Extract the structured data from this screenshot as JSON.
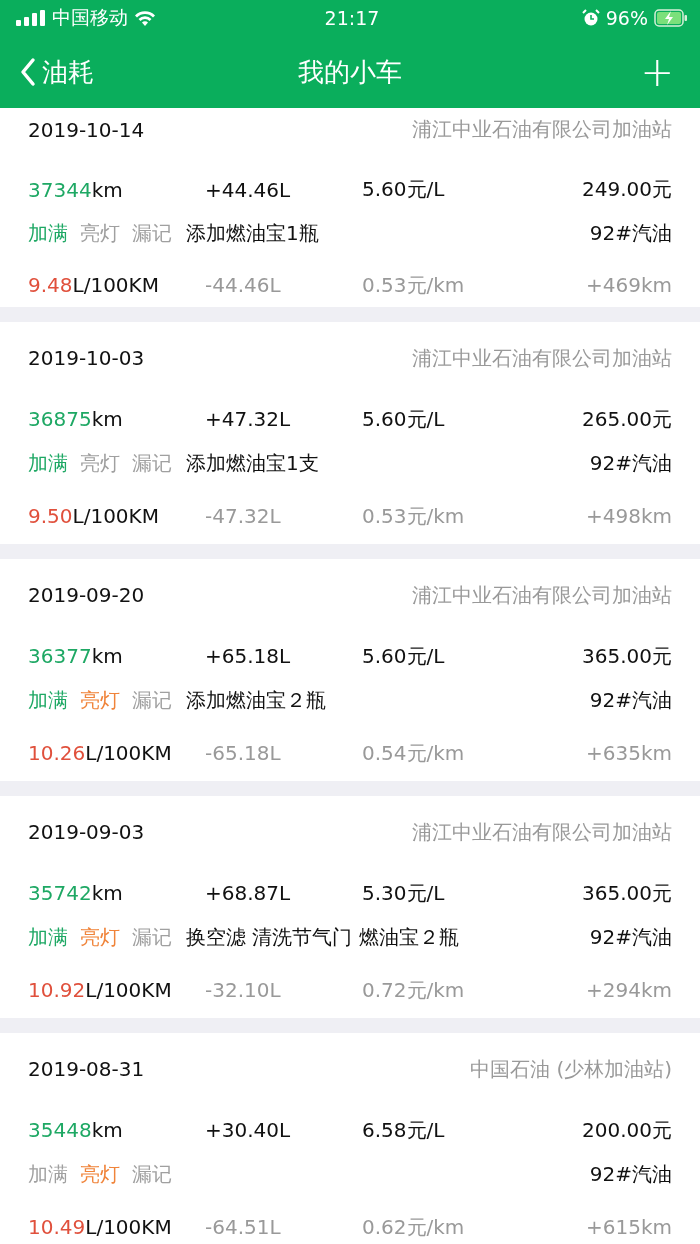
{
  "status_bar": {
    "carrier": "中国移动",
    "time": "21:17",
    "battery": "96%"
  },
  "nav": {
    "back": "油耗",
    "title": "我的小车",
    "add": "+"
  },
  "records": [
    {
      "date": "2019-10-14",
      "station": "浦江中业石油有限公司加油站",
      "odometer": "37344",
      "odometer_unit": "km",
      "volume": "+44.46L",
      "price": "5.60元/L",
      "total": "249.00元",
      "flags": [
        {
          "label": "加满",
          "kind": "full",
          "on": true
        },
        {
          "label": "亮灯",
          "kind": "light",
          "on": false
        },
        {
          "label": "漏记",
          "kind": "missed",
          "on": false
        }
      ],
      "note": "添加燃油宝1瓶",
      "fuel": "92#汽油",
      "consumption": "9.48",
      "consumption_unit": "L/100KM",
      "delta": "-44.46L",
      "cost_per_km": "0.53元/km",
      "distance": "+469km"
    },
    {
      "date": "2019-10-03",
      "station": "浦江中业石油有限公司加油站",
      "odometer": "36875",
      "odometer_unit": "km",
      "volume": "+47.32L",
      "price": "5.60元/L",
      "total": "265.00元",
      "flags": [
        {
          "label": "加满",
          "kind": "full",
          "on": true
        },
        {
          "label": "亮灯",
          "kind": "light",
          "on": false
        },
        {
          "label": "漏记",
          "kind": "missed",
          "on": false
        }
      ],
      "note": "添加燃油宝1支",
      "fuel": "92#汽油",
      "consumption": "9.50",
      "consumption_unit": "L/100KM",
      "delta": "-47.32L",
      "cost_per_km": "0.53元/km",
      "distance": "+498km"
    },
    {
      "date": "2019-09-20",
      "station": "浦江中业石油有限公司加油站",
      "odometer": "36377",
      "odometer_unit": "km",
      "volume": "+65.18L",
      "price": "5.60元/L",
      "total": "365.00元",
      "flags": [
        {
          "label": "加满",
          "kind": "full",
          "on": true
        },
        {
          "label": "亮灯",
          "kind": "light",
          "on": true
        },
        {
          "label": "漏记",
          "kind": "missed",
          "on": false
        }
      ],
      "note": "添加燃油宝２瓶",
      "fuel": "92#汽油",
      "consumption": "10.26",
      "consumption_unit": "L/100KM",
      "delta": "-65.18L",
      "cost_per_km": "0.54元/km",
      "distance": "+635km"
    },
    {
      "date": "2019-09-03",
      "station": "浦江中业石油有限公司加油站",
      "odometer": "35742",
      "odometer_unit": "km",
      "volume": "+68.87L",
      "price": "5.30元/L",
      "total": "365.00元",
      "flags": [
        {
          "label": "加满",
          "kind": "full",
          "on": true
        },
        {
          "label": "亮灯",
          "kind": "light",
          "on": true
        },
        {
          "label": "漏记",
          "kind": "missed",
          "on": false
        }
      ],
      "note": "换空滤 清洗节气门 燃油宝２瓶",
      "fuel": "92#汽油",
      "consumption": "10.92",
      "consumption_unit": "L/100KM",
      "delta": "-32.10L",
      "cost_per_km": "0.72元/km",
      "distance": "+294km"
    },
    {
      "date": "2019-08-31",
      "station": "中国石油 (少林加油站)",
      "odometer": "35448",
      "odometer_unit": "km",
      "volume": "+30.40L",
      "price": "6.58元/L",
      "total": "200.00元",
      "flags": [
        {
          "label": "加满",
          "kind": "full",
          "on": false
        },
        {
          "label": "亮灯",
          "kind": "light",
          "on": true
        },
        {
          "label": "漏记",
          "kind": "missed",
          "on": false
        }
      ],
      "fuel": "92#汽油",
      "consumption": "10.49",
      "consumption_unit": "L/100KM",
      "delta": "-64.51L",
      "cost_per_km": "0.62元/km",
      "distance": "+615km"
    }
  ]
}
